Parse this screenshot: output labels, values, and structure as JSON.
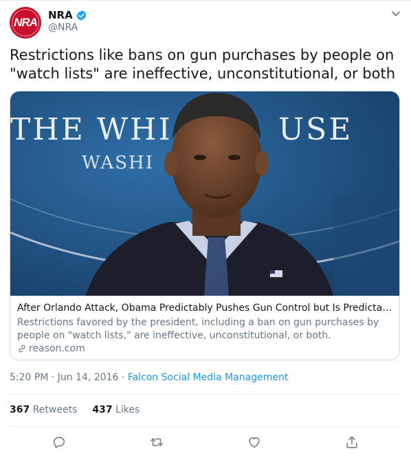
{
  "account": {
    "name": "NRA",
    "handle": "@NRA",
    "avatar_text": "NRA",
    "verified": true
  },
  "tweet": {
    "text": "Restrictions like bans on gun purchases by people on \"watch lists\" are ineffective, unconstitutional, or both"
  },
  "card": {
    "image_subject": "photo-of-barack-obama-at-white-house-podium",
    "image_sign_letters": "THE WHI  USE  WASHI",
    "title": "After Orlando Attack, Obama Predictably Pushes Gun Control but Is Predictably Wrong",
    "description": "Restrictions favored by the president, including a ban on gun purchases by people on \"watch lists,\" are ineffective, unconstitutional, or both.",
    "domain": "reason.com"
  },
  "meta": {
    "time": "5:20 PM",
    "separator": " · ",
    "date": "Jun 14, 2016",
    "source": "Falcon Social Media Management"
  },
  "stats": {
    "retweets_count": "367",
    "retweets_label": "Retweets",
    "likes_count": "437",
    "likes_label": "Likes"
  },
  "icons": {
    "reply": "reply-icon",
    "retweet": "retweet-icon",
    "like": "heart-icon",
    "share": "share-icon",
    "more": "chevron-down-icon",
    "link": "link-icon",
    "verified": "verified-badge-icon"
  },
  "colors": {
    "brand_red": "#c8102e",
    "link_blue": "#1b95e0",
    "verified_blue": "#1da1f2",
    "secondary_text": "#657786"
  }
}
